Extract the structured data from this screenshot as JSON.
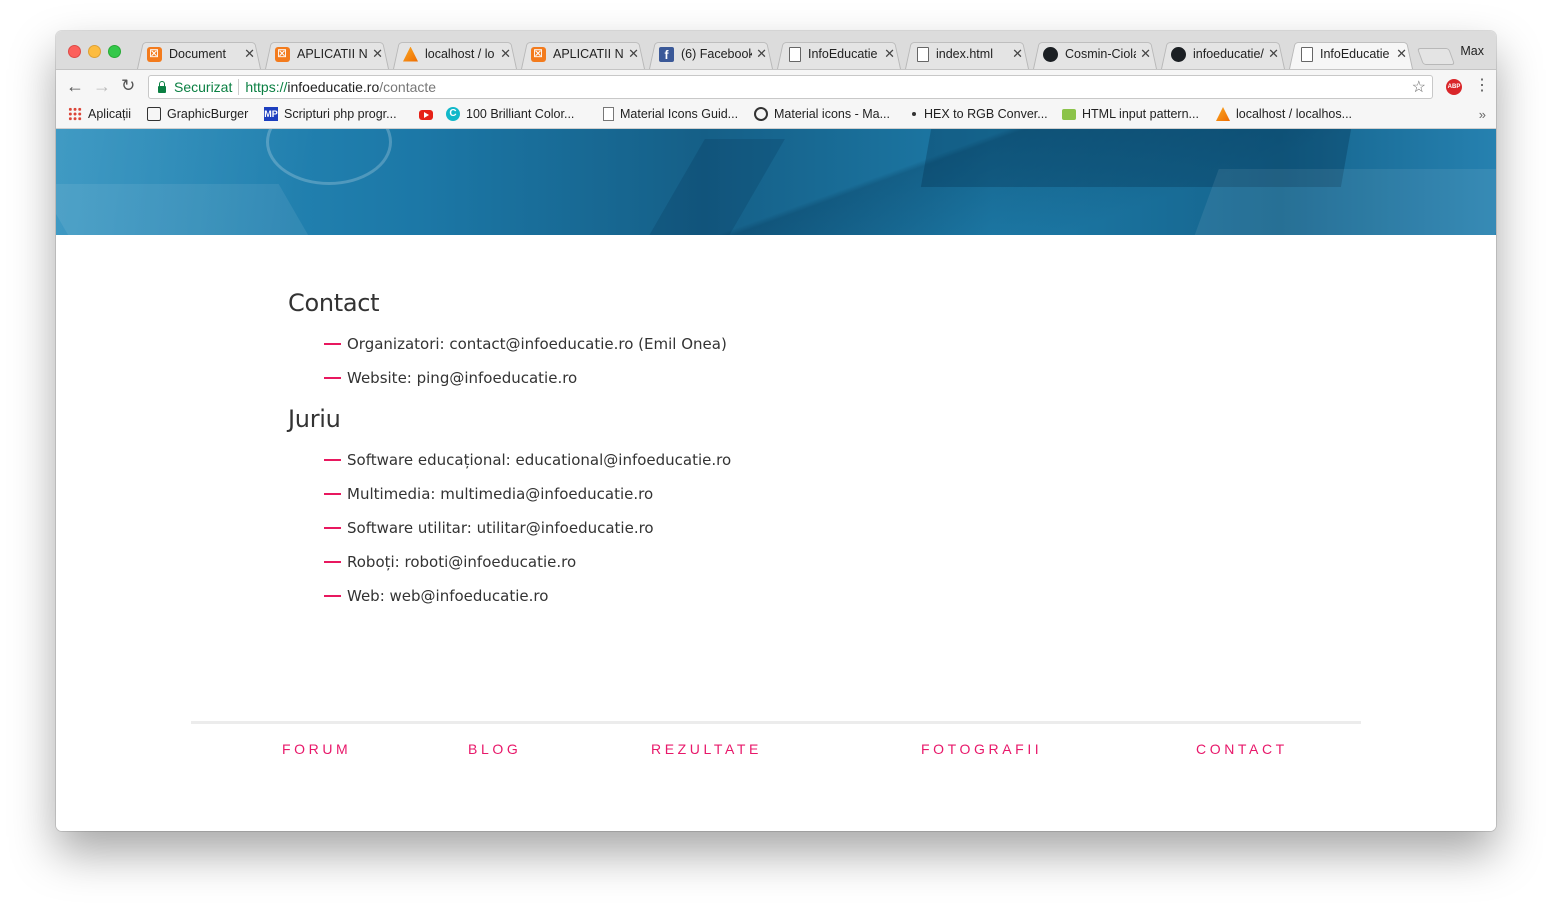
{
  "browser": {
    "tabs": [
      {
        "title": "Document",
        "icon": "xampp-icon"
      },
      {
        "title": "APLICATII NC",
        "icon": "xampp-icon"
      },
      {
        "title": "localhost / lo",
        "icon": "phpmyadmin-icon"
      },
      {
        "title": "APLICATII NC",
        "icon": "xampp-icon"
      },
      {
        "title": "(6) Facebook",
        "icon": "facebook-icon"
      },
      {
        "title": "InfoEducatie",
        "icon": "document-icon"
      },
      {
        "title": "index.html",
        "icon": "document-icon"
      },
      {
        "title": "Cosmin-Ciola",
        "icon": "github-icon"
      },
      {
        "title": "infoeducatie/",
        "icon": "github-icon"
      },
      {
        "title": "InfoEducatie",
        "icon": "document-icon",
        "active": true
      }
    ],
    "profile": "Max",
    "address": {
      "secure_label": "Securizat",
      "scheme": "https://",
      "host": "infoeducatie.ro",
      "path": "/contacte"
    },
    "bookmarks": [
      {
        "label": "Aplicații",
        "icon": "apps-icon"
      },
      {
        "label": "GraphicBurger",
        "icon": "graphicburger-icon"
      },
      {
        "label": "Scripturi php progr...",
        "icon": "mp-icon"
      },
      {
        "label": "",
        "icon": "youtube-icon"
      },
      {
        "label": "100 Brilliant Color...",
        "icon": "c-icon"
      },
      {
        "label": "Material Icons Guid...",
        "icon": "document-icon"
      },
      {
        "label": "Material icons - Ma...",
        "icon": "material-icon"
      },
      {
        "label": "HEX to RGB Conver...",
        "icon": "dot-icon"
      },
      {
        "label": "HTML input pattern...",
        "icon": "html-icon"
      },
      {
        "label": "localhost / localhos...",
        "icon": "phpmyadmin-icon"
      }
    ]
  },
  "page": {
    "contact": {
      "heading": "Contact",
      "items": [
        "Organizatori: contact@infoeducatie.ro (Emil Onea)",
        "Website: ping@infoeducatie.ro"
      ]
    },
    "jury": {
      "heading": "Juriu",
      "items": [
        "Software educațional: educational@infoeducatie.ro",
        "Multimedia: multimedia@infoeducatie.ro",
        "Software utilitar: utilitar@infoeducatie.ro",
        "Roboți: roboti@infoeducatie.ro",
        "Web: web@infoeducatie.ro"
      ]
    },
    "footer": {
      "links": [
        "FORUM",
        "BLOG",
        "REZULTATE",
        "FOTOGRAFII",
        "CONTACT"
      ]
    }
  },
  "colors": {
    "accent": "#e8186a",
    "hero": "#1c78a7",
    "secure": "#0b8043"
  }
}
